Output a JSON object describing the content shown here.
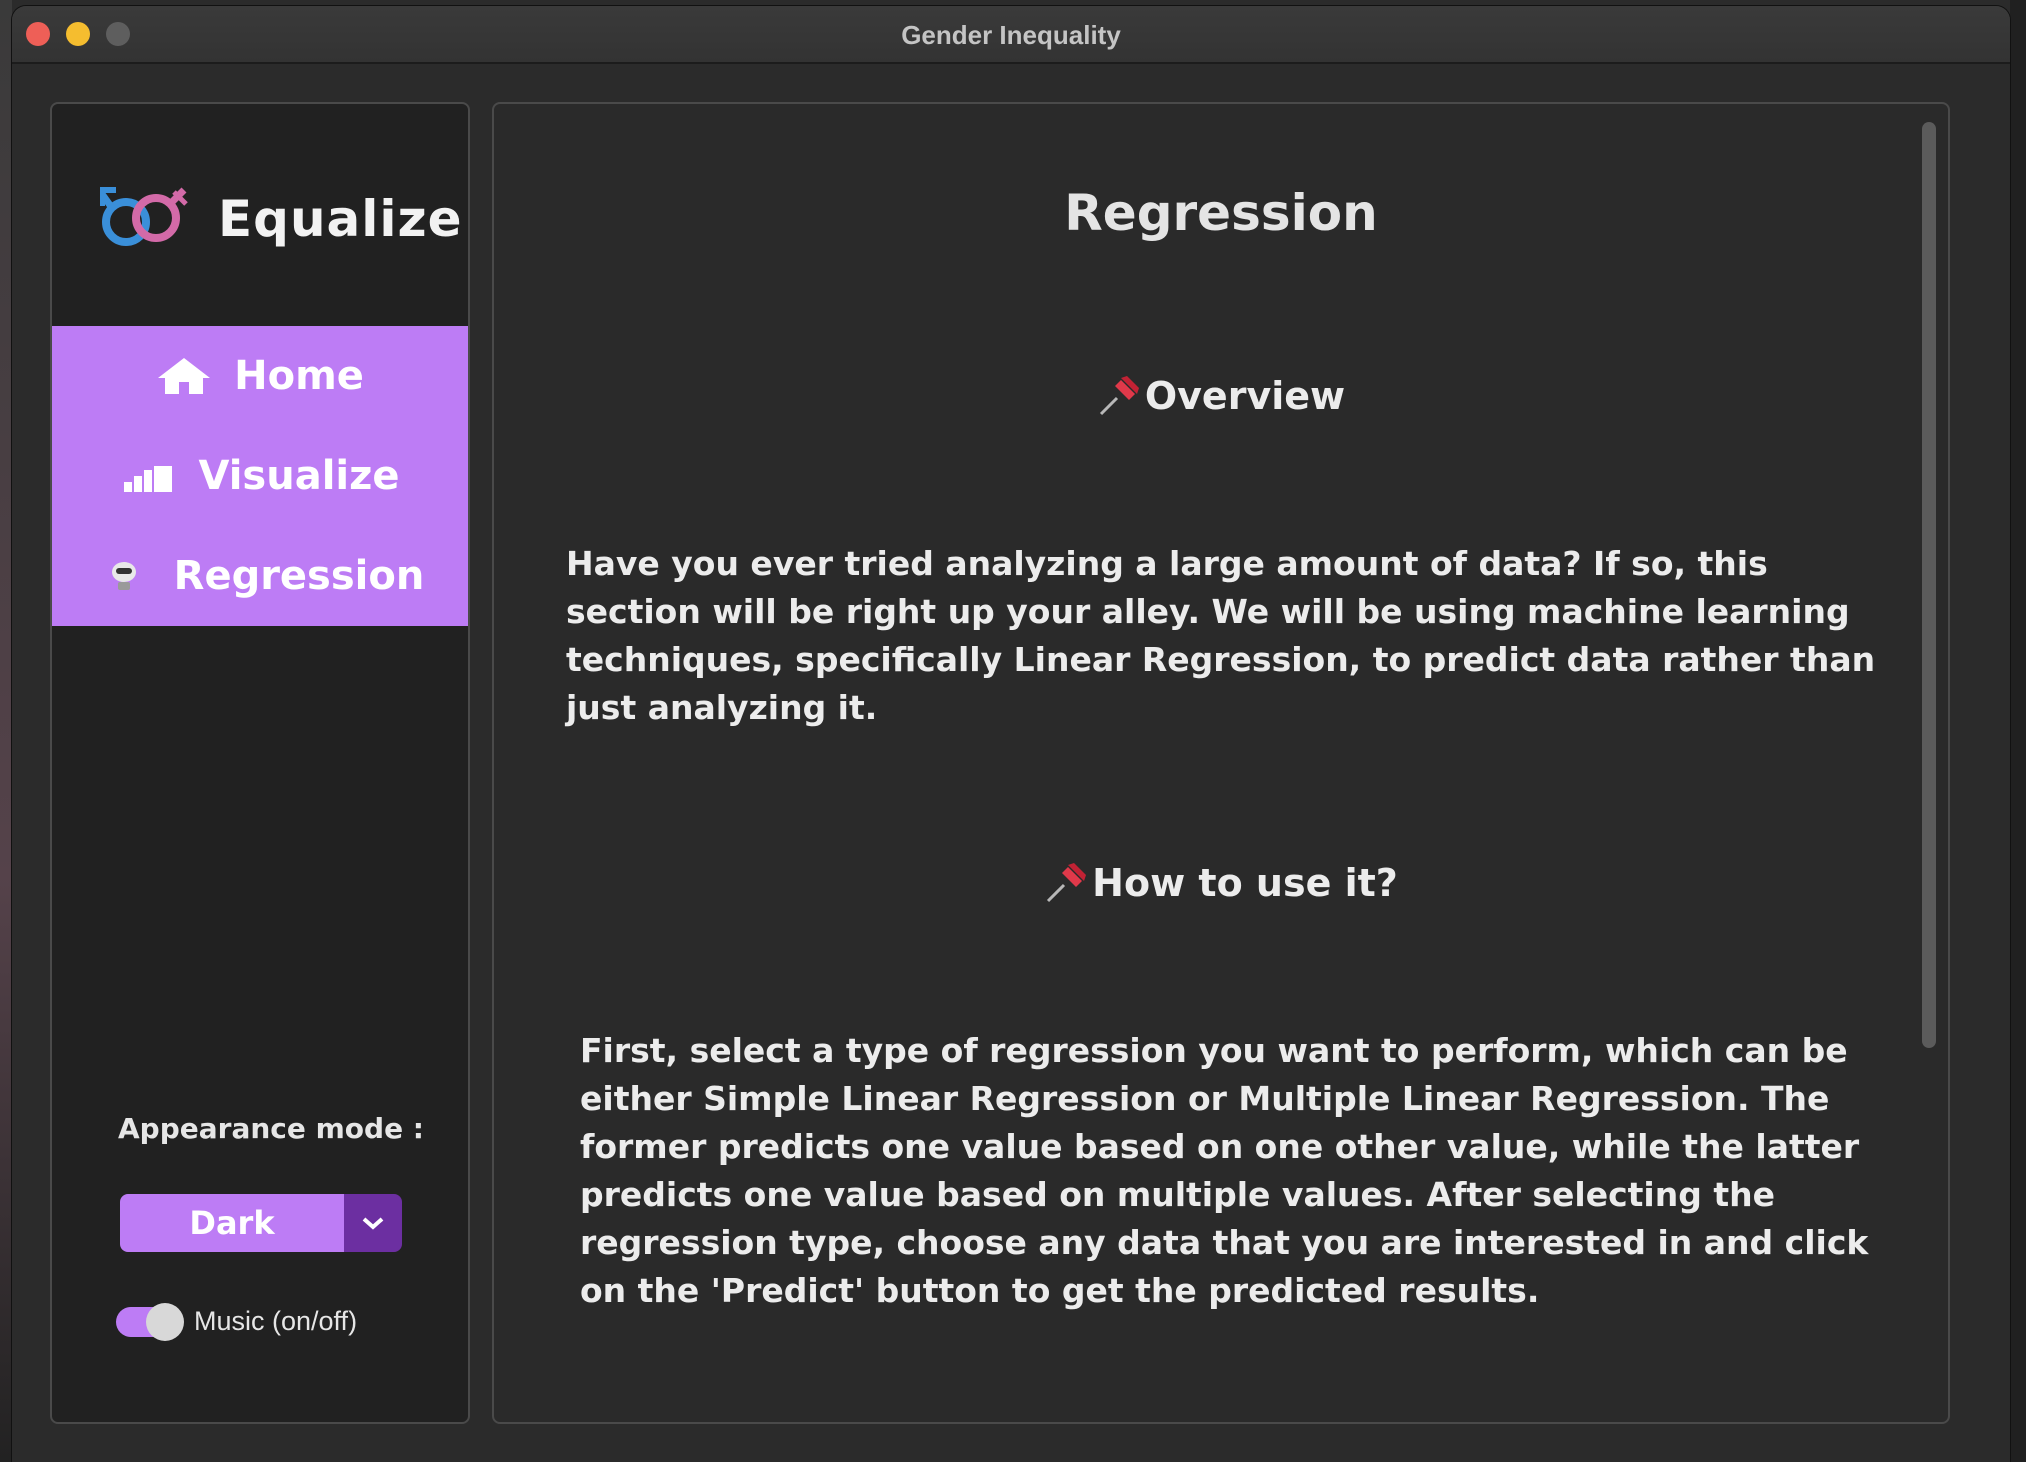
{
  "window": {
    "title": "Gender Inequality"
  },
  "sidebar": {
    "brand_name": "Equalize",
    "nav": [
      {
        "label": "Home",
        "icon": "home-icon"
      },
      {
        "label": "Visualize",
        "icon": "bar-chart-icon"
      },
      {
        "label": "Regression",
        "icon": "robot-icon"
      }
    ],
    "appearance_label": "Appearance mode :",
    "appearance_value": "Dark",
    "music_label": "Music (on/off)",
    "music_on": true
  },
  "content": {
    "title": "Regression",
    "overview_heading": "Overview",
    "overview_text": "Have you ever tried analyzing a large amount of data? If so, this section will be right up your alley. We will be using machine learning techniques, specifically Linear Regression, to predict data rather than just analyzing it.",
    "howto_heading": "How to use it?",
    "howto_text": "First, select a type of regression you want to perform, which can be either Simple Linear Regression or Multiple Linear Regression. The former predicts one value based on one other value, while the latter predicts one value based on multiple values. After selecting the regression type, choose any data that you are interested in and click on the 'Predict' button to get the predicted results."
  },
  "colors": {
    "accent": "#bd7cf5",
    "accent_dark": "#6c2fa1",
    "background": "#2b2b2b",
    "sidebar_bg": "#212121"
  }
}
